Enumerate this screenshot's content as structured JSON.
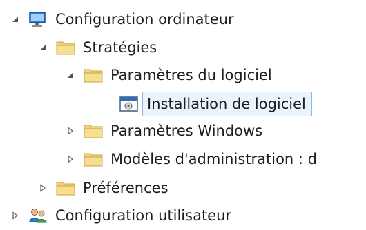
{
  "tree": {
    "items": [
      {
        "label": "Configuration ordinateur",
        "state": "expanded",
        "icon": "computer-icon"
      },
      {
        "label": "Stratégies",
        "state": "expanded",
        "icon": "folder-icon"
      },
      {
        "label": "Paramètres du logiciel",
        "state": "expanded",
        "icon": "folder-icon"
      },
      {
        "label": "Installation de logiciel",
        "state": "selected",
        "icon": "software-install-icon"
      },
      {
        "label": "Paramètres Windows",
        "state": "collapsed",
        "icon": "folder-icon"
      },
      {
        "label": "Modèles d'administration : d",
        "state": "collapsed",
        "icon": "folder-icon"
      },
      {
        "label": "Préférences",
        "state": "collapsed",
        "icon": "folder-icon"
      },
      {
        "label": "Configuration utilisateur",
        "state": "collapsed",
        "icon": "users-icon"
      }
    ]
  },
  "colors": {
    "selection_bg": "#eaf4fd",
    "selection_border": "#8fb7e3",
    "folder": "#f3d37a"
  }
}
